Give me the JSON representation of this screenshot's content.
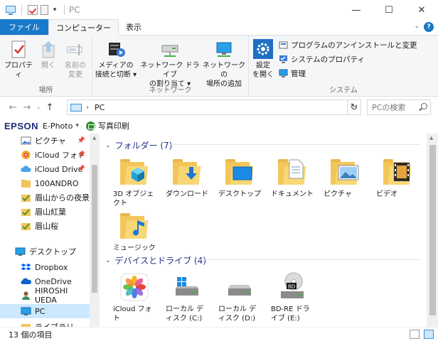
{
  "window": {
    "title": "PC",
    "controls": {
      "minimize": "—",
      "maximize": "☐",
      "close": "✕"
    }
  },
  "tabs": [
    {
      "label": "ファイル"
    },
    {
      "label": "コンピューター"
    },
    {
      "label": "表示"
    }
  ],
  "ribbon": {
    "groups": {
      "location": "場所",
      "network": "ネットワーク",
      "system": "システム"
    },
    "buttons": {
      "properties": "プロパティ",
      "open": "開く",
      "rename_1": "名前の",
      "rename_2": "変更",
      "media_1": "メディアの",
      "media_2": "接続と切断 ▾",
      "mapdrive_1": "ネットワーク ドライブ",
      "mapdrive_2": "の割り当て ▾",
      "addnet_1": "ネットワークの",
      "addnet_2": "場所の追加",
      "settings_1": "設定",
      "settings_2": "を開く",
      "uninstall": "プログラムのアンインストールと変更",
      "sysprops": "システムのプロパティ",
      "manage": "管理"
    }
  },
  "address": {
    "path": "PC",
    "search_placeholder": "PCの検索"
  },
  "epson": {
    "logo": "EPSON",
    "app": "E-Photo",
    "print": "写真印刷"
  },
  "nav": [
    {
      "label": "ピクチャ",
      "pinned": "📌"
    },
    {
      "label": "iCloud フォト",
      "pinned": "📌"
    },
    {
      "label": "iCloud Drive",
      "pinned": "📌"
    },
    {
      "label": "100ANDRO"
    },
    {
      "label": "眉山からの夜景"
    },
    {
      "label": "眉山紅葉"
    },
    {
      "label": "眉山桜"
    },
    {
      "label": "デスクトップ"
    },
    {
      "label": "Dropbox"
    },
    {
      "label": "OneDrive"
    },
    {
      "label": "HIROSHI UEDA"
    },
    {
      "label": "PC"
    },
    {
      "label": "ライブラリ"
    }
  ],
  "sections": {
    "folders": "フォルダー (7)",
    "drives": "デバイスとドライブ (4)"
  },
  "folders": [
    {
      "label": "3D オブジェクト"
    },
    {
      "label": "ダウンロード"
    },
    {
      "label": "デスクトップ"
    },
    {
      "label": "ドキュメント"
    },
    {
      "label": "ピクチャ"
    },
    {
      "label": "ビデオ"
    },
    {
      "label": "ミュージック"
    }
  ],
  "drives": [
    {
      "label": "iCloud フォト"
    },
    {
      "label": "ローカル ディスク (C:)"
    },
    {
      "label": "ローカル ディスク (D:)"
    },
    {
      "label": "BD-RE ドライブ (E:)"
    }
  ],
  "status": {
    "count": "13 個の項目"
  },
  "colors": {
    "accent": "#1979ca",
    "selected": "#cce8ff",
    "section_text": "#1e3287",
    "folder": "#f2c65a"
  }
}
